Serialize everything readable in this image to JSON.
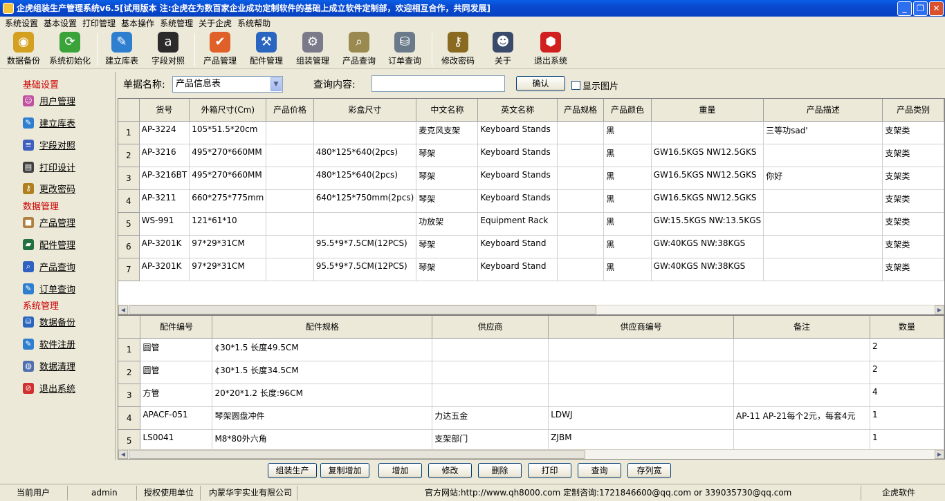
{
  "window": {
    "title": "企虎组装生产管理系统v6.5[试用版本 注:企虎在为数百家企业成功定制软件的基础上成立软件定制部，欢迎相互合作，共同发展]",
    "minimize": "_",
    "maximize": "❐",
    "close": "✕"
  },
  "menu": [
    "系统设置",
    "基本设置",
    "打印管理",
    "基本操作",
    "系统管理",
    "关于企虎",
    "系统帮助"
  ],
  "toolbar": [
    {
      "label": "数据备份",
      "icon": "database-backup-icon",
      "glyph": "◉",
      "color": "#d4a020"
    },
    {
      "label": "系统初始化",
      "icon": "refresh-icon",
      "glyph": "⟳",
      "color": "#3aa33a"
    },
    {
      "label": "建立库表",
      "icon": "create-table-icon",
      "glyph": "✎",
      "color": "#2f7fd0"
    },
    {
      "label": "字段对照",
      "icon": "amazon-a-icon",
      "glyph": "a",
      "color": "#2b2b2b"
    },
    {
      "label": "产品管理",
      "icon": "check-badge-icon",
      "glyph": "✔",
      "color": "#e0602a"
    },
    {
      "label": "配件管理",
      "icon": "hammer-icon",
      "glyph": "⚒",
      "color": "#2a66c0"
    },
    {
      "label": "组装管理",
      "icon": "database-gear-icon",
      "glyph": "⚙",
      "color": "#7a7a8a"
    },
    {
      "label": "产品查询",
      "icon": "magnifier-icon",
      "glyph": "⌕",
      "color": "#9a8a50"
    },
    {
      "label": "订单查询",
      "icon": "database-search-icon",
      "glyph": "⛁",
      "color": "#6a7a8a"
    },
    {
      "label": "修改密码",
      "icon": "key-icon",
      "glyph": "⚷",
      "color": "#8a6a20"
    },
    {
      "label": "关于",
      "icon": "mascot-icon",
      "glyph": "☻",
      "color": "#3a4a6a"
    },
    {
      "label": "退出系统",
      "icon": "exit-cube-icon",
      "glyph": "⬢",
      "color": "#d02020"
    }
  ],
  "sidebar": {
    "groups": [
      "基础设置",
      "数据管理",
      "系统管理"
    ],
    "items": [
      {
        "label": "用户管理",
        "icon": "user-icon",
        "glyph": "☺",
        "color": "#c050a0"
      },
      {
        "label": "建立库表",
        "icon": "create-table-icon",
        "glyph": "✎",
        "color": "#2f7fd0"
      },
      {
        "label": "字段对照",
        "icon": "field-map-icon",
        "glyph": "≡",
        "color": "#4060c0"
      },
      {
        "label": "打印设计",
        "icon": "printer-icon",
        "glyph": "▤",
        "color": "#404040"
      },
      {
        "label": "更改密码",
        "icon": "key-icon",
        "glyph": "⚷",
        "color": "#b08020"
      },
      {
        "label": "产品管理",
        "icon": "box-icon",
        "glyph": "■",
        "color": "#b08040"
      },
      {
        "label": "配件管理",
        "icon": "parts-icon",
        "glyph": "▰",
        "color": "#207040"
      },
      {
        "label": "产品查询",
        "icon": "search-icon",
        "glyph": "⌕",
        "color": "#3060c0"
      },
      {
        "label": "订单查询",
        "icon": "order-icon",
        "glyph": "✎",
        "color": "#2f7fd0"
      },
      {
        "label": "数据备份",
        "icon": "backup-icon",
        "glyph": "⛁",
        "color": "#2a66c0"
      },
      {
        "label": "软件注册",
        "icon": "register-icon",
        "glyph": "✎",
        "color": "#2f7fd0"
      },
      {
        "label": "数据清理",
        "icon": "clean-icon",
        "glyph": "◍",
        "color": "#5070b0"
      },
      {
        "label": "退出系统",
        "icon": "exit-icon",
        "glyph": "⊘",
        "color": "#d03030"
      }
    ]
  },
  "query": {
    "doc_label": "单据名称:",
    "doc_value": "产品信息表",
    "content_label": "查询内容:",
    "content_value": "",
    "confirm": "确认",
    "show_image": "显示图片"
  },
  "product_grid": {
    "columns": [
      "货号",
      "外箱尺寸(Cm)",
      "产品价格",
      "彩盒尺寸",
      "中文名称",
      "英文名称",
      "产品规格",
      "产品颜色",
      "重量",
      "产品描述",
      "产品类别"
    ],
    "rows": [
      {
        "n": "1",
        "cells": [
          "AP-3224",
          "105*51.5*20cm",
          "",
          "",
          "麦克风支架",
          "Keyboard Stands",
          "",
          "黑",
          "",
          "三等功sad'",
          "支架类"
        ]
      },
      {
        "n": "2",
        "cells": [
          "AP-3216",
          "495*270*660MM",
          "",
          "480*125*640(2pcs)",
          "琴架",
          "Keyboard Stands",
          "",
          "黑",
          "GW16.5KGS NW12.5GKS",
          "",
          "支架类"
        ]
      },
      {
        "n": "3",
        "cells": [
          "AP-3216BT",
          "495*270*660MM",
          "",
          "480*125*640(2pcs)",
          "琴架",
          "Keyboard Stands",
          "",
          "黑",
          "GW16.5KGS NW12.5GKS",
          "你好",
          "支架类"
        ]
      },
      {
        "n": "4",
        "cells": [
          "AP-3211",
          "660*275*775mm",
          "",
          "640*125*750mm(2pcs)",
          "琴架",
          "Keyboard Stands",
          "",
          "黑",
          "GW16.5KGS NW12.5GKS",
          "",
          "支架类"
        ]
      },
      {
        "n": "5",
        "cells": [
          "WS-991",
          "121*61*10",
          "",
          "",
          "功放架",
          "Equipment Rack",
          "",
          "黑",
          "GW:15.5KGS NW:13.5KGS",
          "",
          "支架类"
        ]
      },
      {
        "n": "6",
        "cells": [
          "AP-3201K",
          "97*29*31CM",
          "",
          "95.5*9*7.5CM(12PCS)",
          "琴架",
          "Keyboard Stand",
          "",
          "黑",
          "GW:40KGS  NW:38KGS",
          "",
          "支架类"
        ]
      },
      {
        "n": "7",
        "cells": [
          "AP-3201K",
          "97*29*31CM",
          "",
          "95.5*9*7.5CM(12PCS)",
          "琴架",
          "Keyboard Stand",
          "",
          "黑",
          "GW:40KGS  NW:38KGS",
          "",
          "支架类"
        ]
      }
    ]
  },
  "parts_grid": {
    "columns": [
      "配件编号",
      "配件规格",
      "供应商",
      "供应商编号",
      "备注",
      "数量"
    ],
    "rows": [
      {
        "n": "1",
        "cells": [
          "圆管",
          "¢30*1.5   长度49.5CM",
          "",
          "",
          "",
          "2"
        ]
      },
      {
        "n": "2",
        "cells": [
          "圆管",
          "¢30*1.5   长度34.5CM",
          "",
          "",
          "",
          "2"
        ]
      },
      {
        "n": "3",
        "cells": [
          "方管",
          "20*20*1.2  长度:96CM",
          "",
          "",
          "",
          "4"
        ]
      },
      {
        "n": "4",
        "cells": [
          "APACF-051",
          "琴架圆盘冲件",
          "力达五金",
          "LDWJ",
          "AP-11 AP-21每个2元，每套4元",
          "1"
        ]
      },
      {
        "n": "5",
        "cells": [
          "LS0041",
          "M8*80外六角",
          "支架部门",
          "ZJBM",
          "",
          "1"
        ]
      }
    ]
  },
  "actions": [
    "组装生产",
    "复制增加",
    "增加",
    "修改",
    "删除",
    "打印",
    "查询",
    "存列宽"
  ],
  "status": {
    "user_label": "当前用户",
    "user": "admin",
    "org_label": "授权使用单位",
    "org": "内蒙华宇实业有限公司",
    "site": "官方网站:http://www.qh8000.com 定制咨询:1721846600@qq.com or 339035730@qq.com",
    "brand": "企虎软件"
  }
}
